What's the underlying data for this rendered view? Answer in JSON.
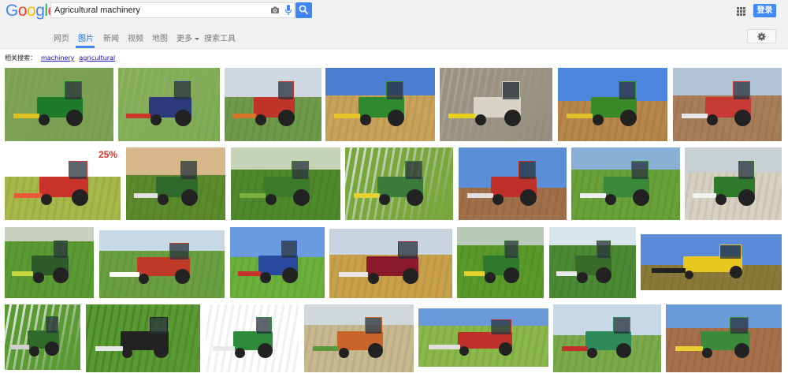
{
  "logo": {
    "letters": [
      "G",
      "o",
      "o",
      "g",
      "l",
      "e"
    ],
    "colors": [
      "#4285f4",
      "#ea4335",
      "#fbbc05",
      "#4285f4",
      "#34a853",
      "#ea4335"
    ]
  },
  "search": {
    "query": "Agricultural machinery",
    "camera_icon": "camera-icon",
    "mic_icon": "mic-icon",
    "search_icon": "search-icon"
  },
  "header": {
    "apps_icon": "apps-grid-icon",
    "signin_label": "登录"
  },
  "tabs": [
    {
      "label": "网页",
      "active": false
    },
    {
      "label": "图片",
      "active": true
    },
    {
      "label": "新闻",
      "active": false
    },
    {
      "label": "视频",
      "active": false
    },
    {
      "label": "地图",
      "active": false
    },
    {
      "label": "更多",
      "active": false
    },
    {
      "label": "搜索工具",
      "active": false
    }
  ],
  "settings_icon": "gear-icon",
  "related": {
    "label": "相关搜索：",
    "links": [
      "machinery",
      "agricultural"
    ]
  },
  "colors": {
    "accent": "#4285f4",
    "bar_bg": "#f1f1f1",
    "link": "#1a0dab"
  },
  "thumbnails": [
    {
      "overlay_text": ""
    },
    {
      "overlay_text": ""
    },
    {
      "overlay_text": ""
    },
    {
      "overlay_text": ""
    },
    {
      "overlay_text": ""
    },
    {
      "overlay_text": ""
    },
    {
      "overlay_text": ""
    },
    {
      "overlay_text": "25%"
    },
    {
      "overlay_text": ""
    },
    {
      "overlay_text": ""
    },
    {
      "overlay_text": ""
    },
    {
      "overlay_text": ""
    },
    {
      "overlay_text": ""
    },
    {
      "overlay_text": ""
    },
    {
      "overlay_text": ""
    },
    {
      "overlay_text": ""
    },
    {
      "overlay_text": ""
    },
    {
      "overlay_text": ""
    },
    {
      "overlay_text": ""
    },
    {
      "overlay_text": ""
    },
    {
      "overlay_text": ""
    },
    {
      "overlay_text": ""
    },
    {
      "overlay_text": ""
    },
    {
      "overlay_text": ""
    },
    {
      "overlay_text": ""
    },
    {
      "overlay_text": ""
    },
    {
      "overlay_text": ""
    },
    {
      "overlay_text": ""
    }
  ]
}
